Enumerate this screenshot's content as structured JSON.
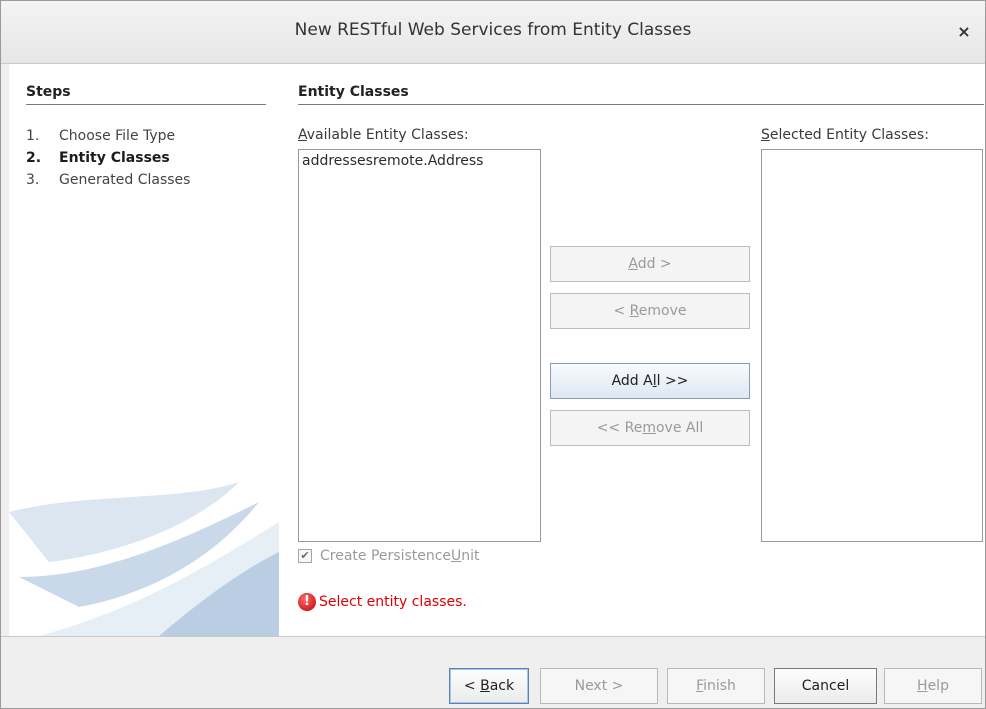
{
  "dialog": {
    "title": "New RESTful Web Services from Entity Classes",
    "close_glyph": "×"
  },
  "steps": {
    "heading": "Steps",
    "items": [
      {
        "num": "1.",
        "label": "Choose File Type"
      },
      {
        "num": "2.",
        "label": "Entity Classes"
      },
      {
        "num": "3.",
        "label": "Generated Classes"
      }
    ],
    "current_index": 1
  },
  "panel": {
    "heading": "Entity Classes",
    "available_label_mnemonic": "A",
    "available_label_rest": "vailable Entity Classes:",
    "selected_label_mnemonic": "S",
    "selected_label_rest": "elected Entity Classes:",
    "available_items": [
      "addressesremote.Address"
    ],
    "selected_items": [],
    "buttons": {
      "add_m": "A",
      "add_rest": "dd >",
      "remove_pre": "< ",
      "remove_m": "R",
      "remove_rest": "emove",
      "add_all_pre": "Add A",
      "add_all_m": "l",
      "add_all_rest": "l >>",
      "remove_all_pre": "<< Re",
      "remove_all_m": "m",
      "remove_all_rest": "ove All"
    },
    "persistence_pre": "Create Persistence ",
    "persistence_m": "U",
    "persistence_rest": "nit",
    "persistence_checked": true,
    "error_message": "Select entity classes.",
    "error_icon": "!"
  },
  "footer": {
    "back_pre": "< ",
    "back_m": "B",
    "back_rest": "ack",
    "next": "Next >",
    "finish_m": "F",
    "finish_rest": "inish",
    "cancel": "Cancel",
    "help_m": "H",
    "help_rest": "elp"
  },
  "colors": {
    "error": "#e00000",
    "accent": "#5b7fb8"
  }
}
